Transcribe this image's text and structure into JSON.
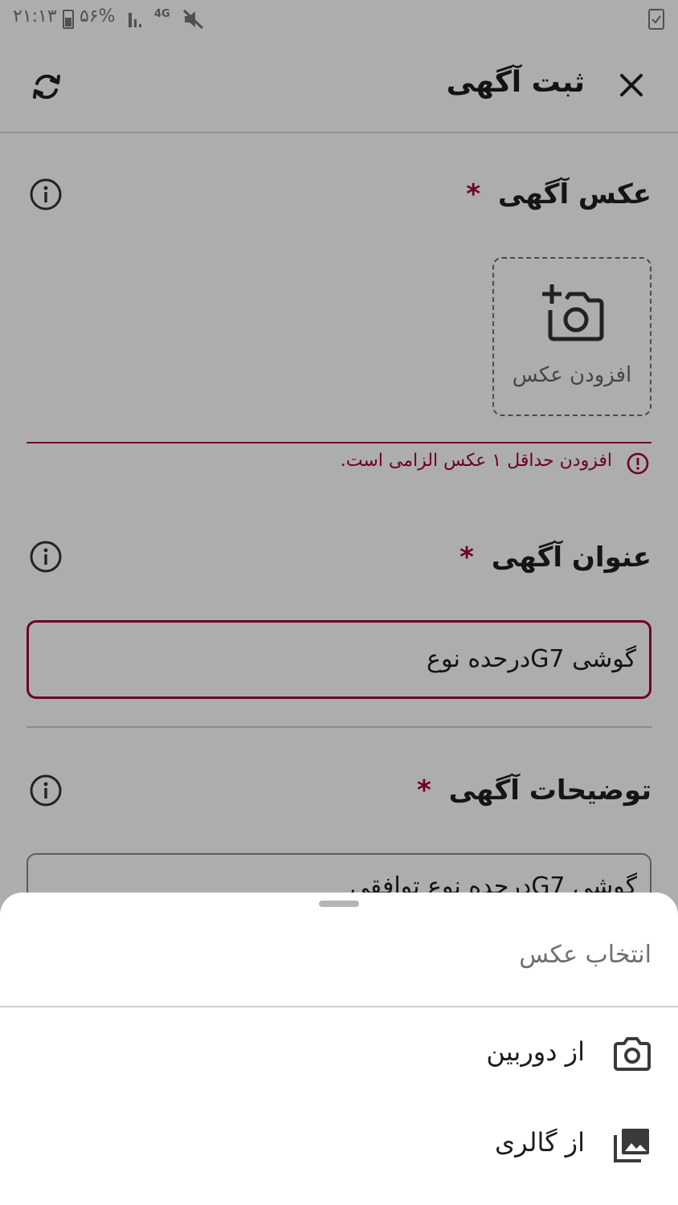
{
  "status_bar": {
    "time": "۲۱:۱۳",
    "battery": "۵۶%",
    "network": "4G"
  },
  "app_bar": {
    "title": "ثبت آگهی"
  },
  "photo_section": {
    "title": "عکس آگهی",
    "required_mark": "*",
    "add_photo_label": "افزودن عکس",
    "error": "افزودن حداقل ۱ عکس الزامی است."
  },
  "title_section": {
    "title": "عنوان آگهی",
    "required_mark": "*",
    "value": "گوشی G7درحده نوع"
  },
  "description_section": {
    "title": "توضیحات آگهی",
    "required_mark": "*",
    "value": "گوشی G7درحده نوع توافقی"
  },
  "bottom_sheet": {
    "title": "انتخاب عکس",
    "options": [
      {
        "label": "از دوربین",
        "icon": "camera-icon"
      },
      {
        "label": "از گالری",
        "icon": "gallery-icon"
      }
    ]
  },
  "colors": {
    "error": "#a3002f",
    "scrim": "rgba(0,0,0,0.32)"
  }
}
